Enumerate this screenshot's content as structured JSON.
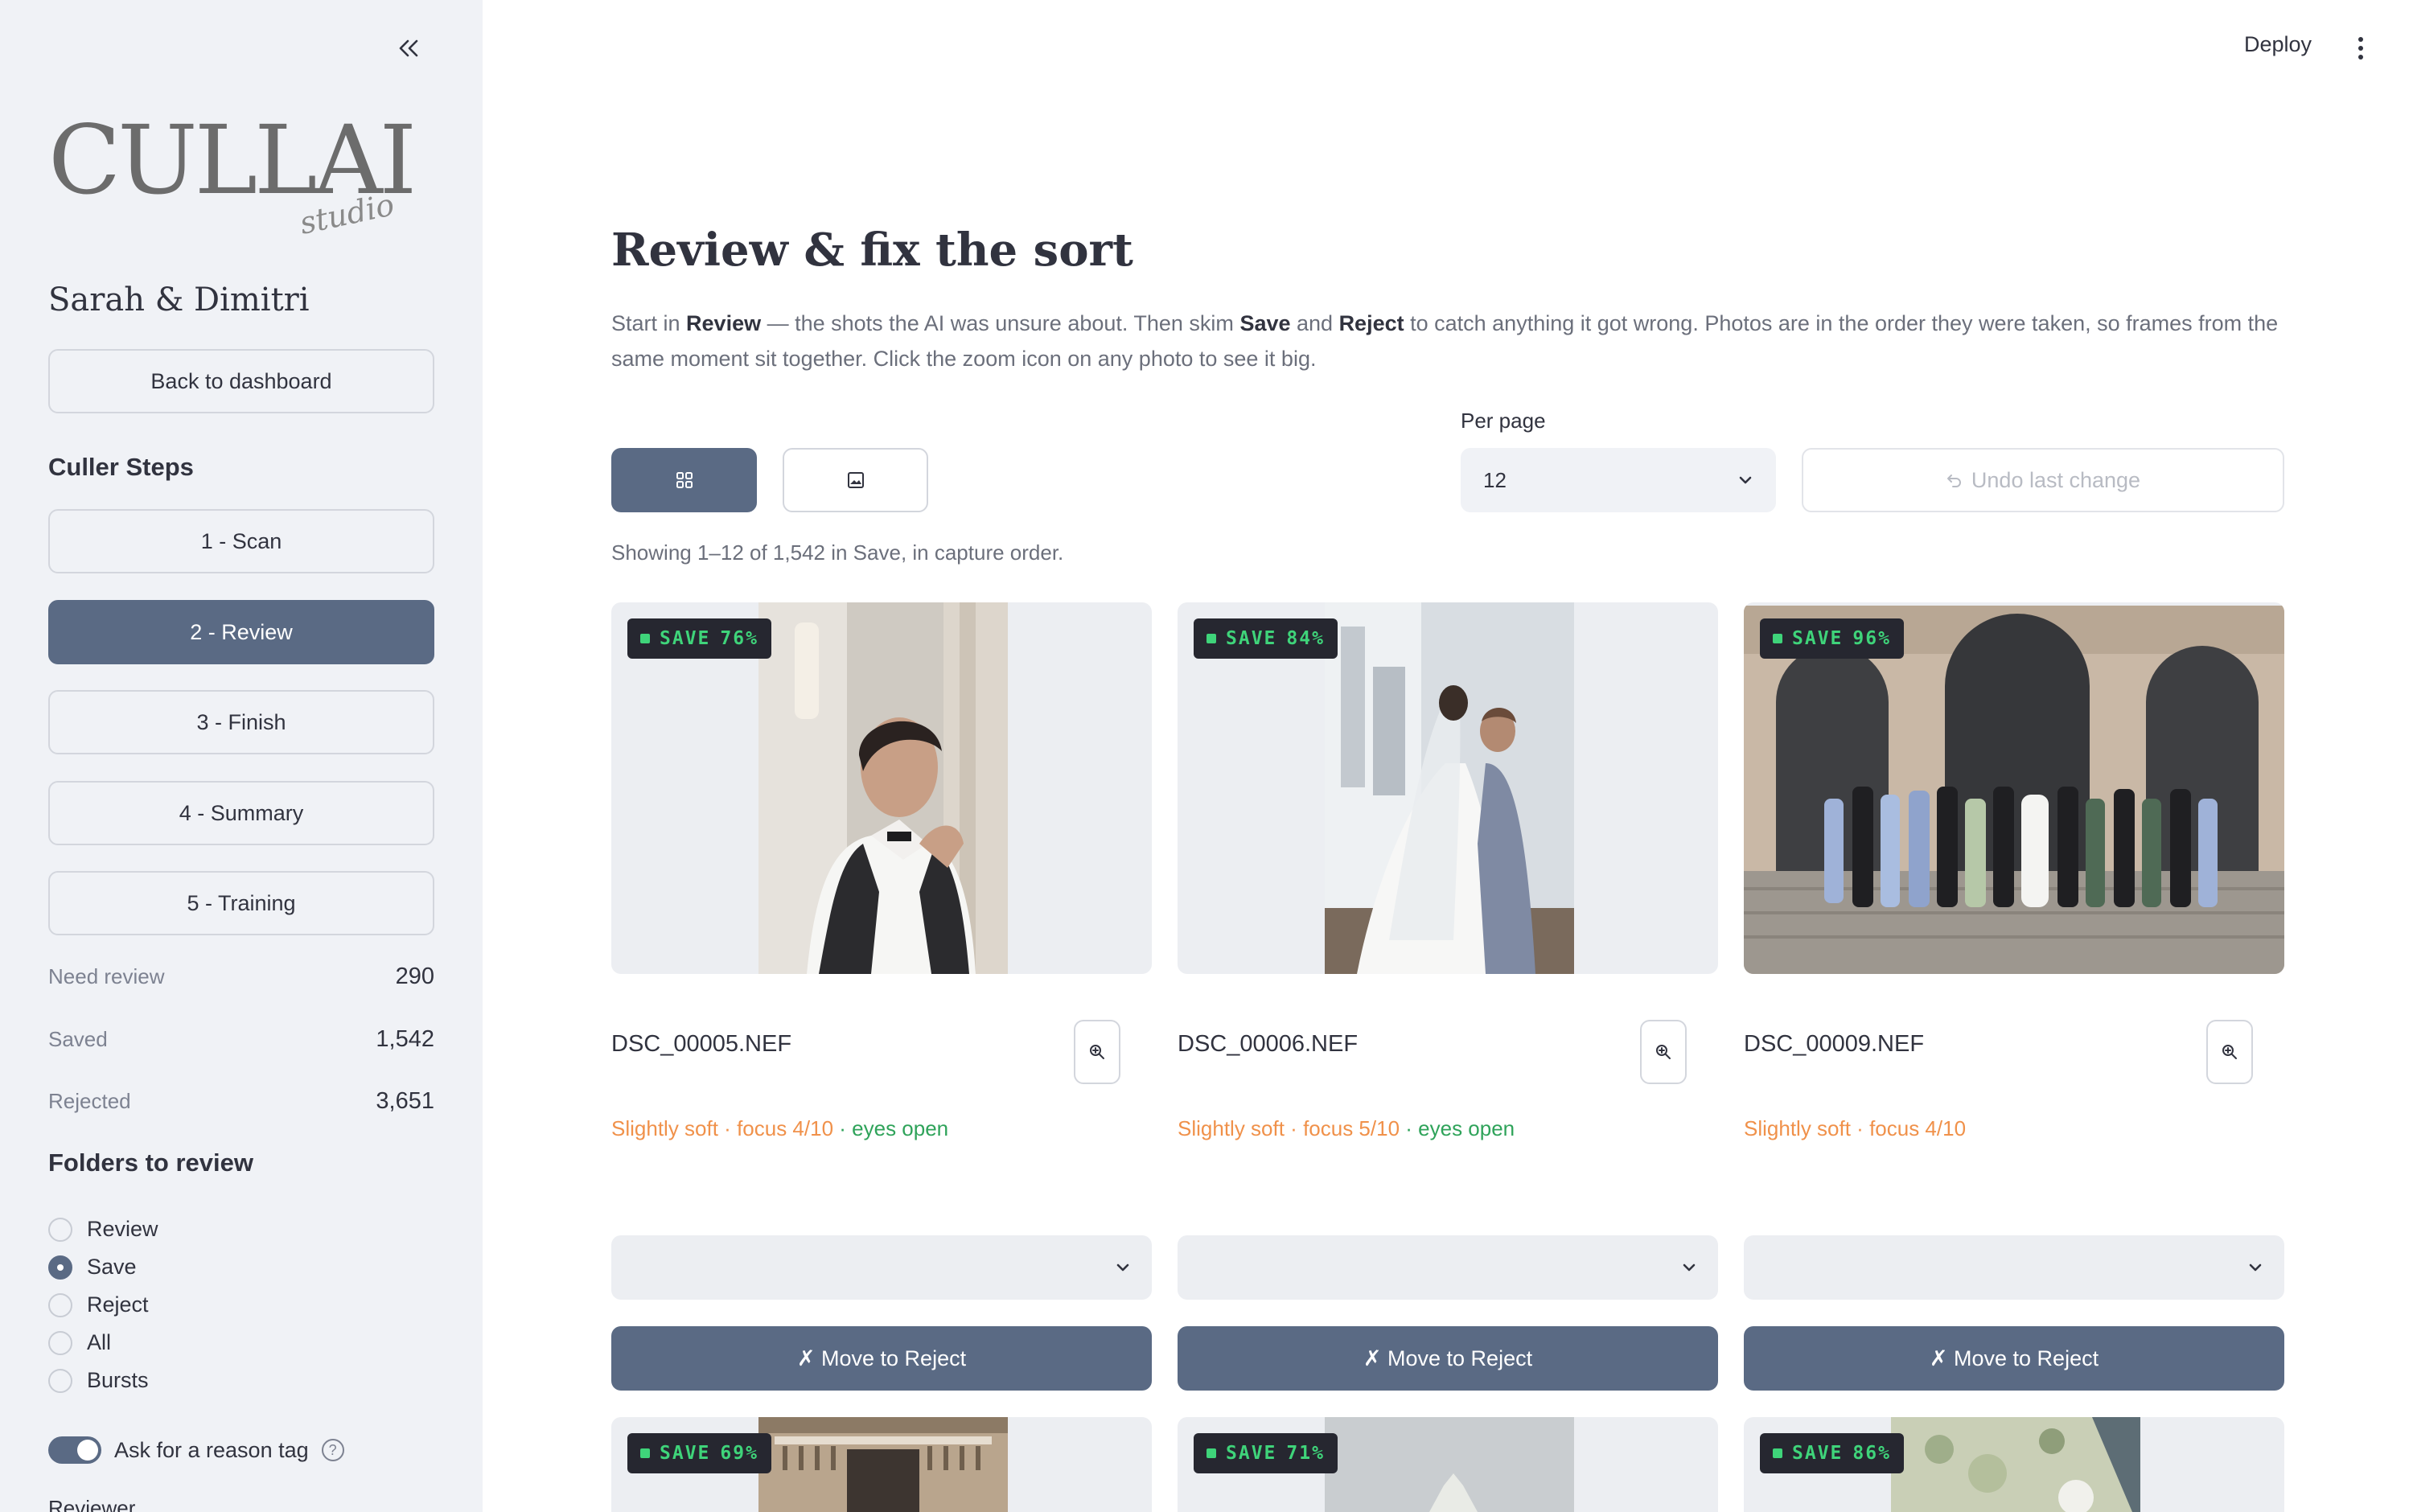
{
  "app": {
    "logo_main": "CULLAI",
    "logo_sub": "studio",
    "deploy_label": "Deploy"
  },
  "sidebar": {
    "project_name": "Sarah & Dimitri",
    "back_label": "Back to dashboard",
    "steps_title": "Culler Steps",
    "steps": [
      {
        "label": "1 - Scan",
        "active": false
      },
      {
        "label": "2 - Review",
        "active": true
      },
      {
        "label": "3 - Finish",
        "active": false
      },
      {
        "label": "4 - Summary",
        "active": false
      },
      {
        "label": "5 - Training",
        "active": false
      }
    ],
    "stats": [
      {
        "label": "Need review",
        "value": "290"
      },
      {
        "label": "Saved",
        "value": "1,542"
      },
      {
        "label": "Rejected",
        "value": "3,651"
      }
    ],
    "folders_title": "Folders to review",
    "folders": [
      {
        "label": "Review",
        "selected": false
      },
      {
        "label": "Save",
        "selected": true
      },
      {
        "label": "Reject",
        "selected": false
      },
      {
        "label": "All",
        "selected": false
      },
      {
        "label": "Bursts",
        "selected": false
      }
    ],
    "reason_toggle_label": "Ask for a reason tag",
    "reason_toggle_on": true,
    "reviewer_label": "Reviewer"
  },
  "main": {
    "title": "Review & fix the sort",
    "intro": {
      "p1": "Start in ",
      "b1": "Review",
      "p2": " — the shots the AI was unsure about. Then skim ",
      "b2": "Save",
      "p3": " and ",
      "b3": "Reject",
      "p4": " to catch anything it got wrong. Photos are in the order they were taken, so frames from the same moment sit together. Click the zoom icon on any photo to see it big."
    },
    "per_page_label": "Per page",
    "per_page_value": "12",
    "undo_label": "Undo last change",
    "showing_text": "Showing 1–12 of 1,542 in Save, in capture order.",
    "photos": [
      {
        "badge": "SAVE",
        "confidence": "76%",
        "filename": "DSC_00005.NEF",
        "soft": "Slightly soft",
        "focus": "focus 4/10",
        "eyes": "eyes open",
        "reason_value": "",
        "move_label": "✗ Move to Reject"
      },
      {
        "badge": "SAVE",
        "confidence": "84%",
        "filename": "DSC_00006.NEF",
        "soft": "Slightly soft",
        "focus": "focus 5/10",
        "eyes": "eyes open",
        "reason_value": "",
        "move_label": "✗ Move to Reject"
      },
      {
        "badge": "SAVE",
        "confidence": "96%",
        "filename": "DSC_00009.NEF",
        "soft": "Slightly soft",
        "focus": "focus 4/10",
        "eyes": "",
        "reason_value": "",
        "move_label": "✗ Move to Reject"
      },
      {
        "badge": "SAVE",
        "confidence": "69%"
      },
      {
        "badge": "SAVE",
        "confidence": "71%"
      },
      {
        "badge": "SAVE",
        "confidence": "86%"
      }
    ],
    "colors": {
      "accent": "#5a6a84",
      "sidebar_bg": "#f0f2f6",
      "badge_green": "#3fd47a",
      "soft_orange": "#f0914a",
      "ok_green": "#2fa35a"
    },
    "icons": {
      "collapse": "double-chevron-left-icon",
      "grid_view": "grid-icon",
      "single_view": "image-icon",
      "zoom": "zoom-in-icon",
      "undo": "undo-icon",
      "menu": "kebab-menu-icon",
      "help": "question-circle-icon"
    }
  }
}
